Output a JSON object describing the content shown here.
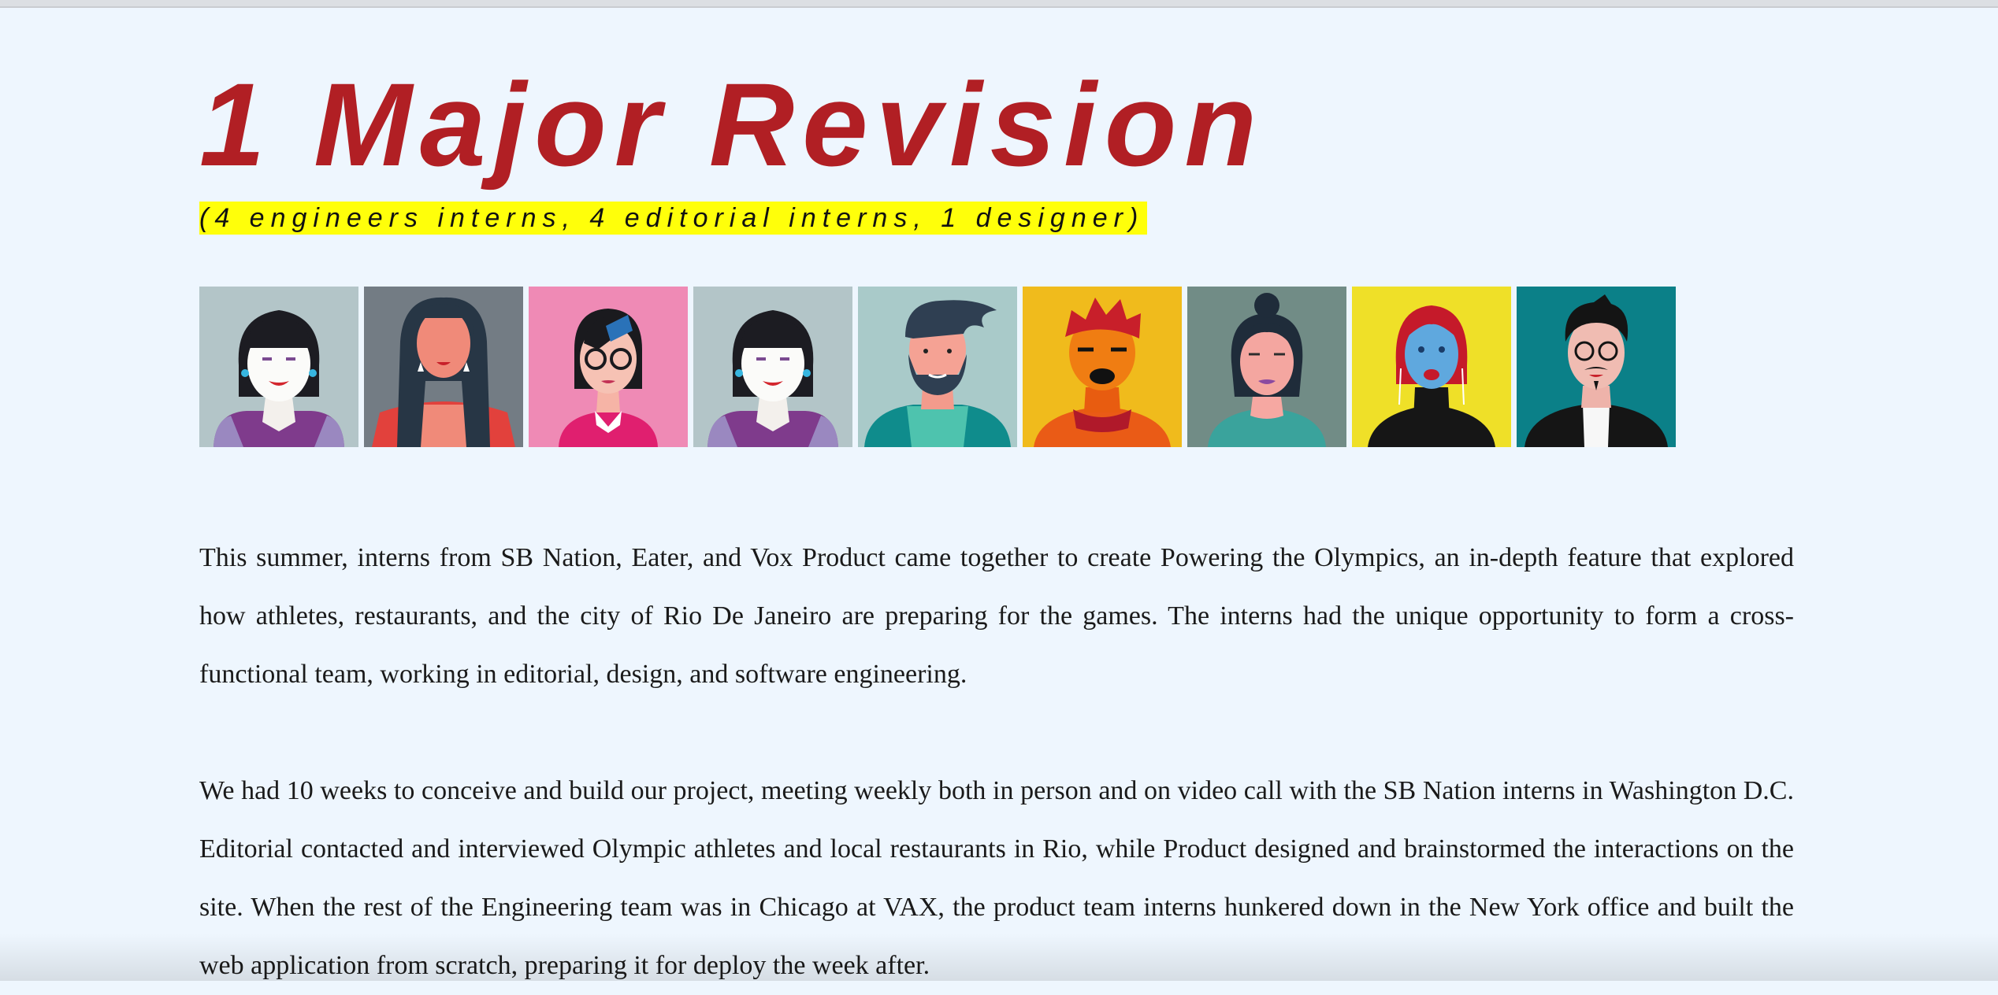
{
  "article": {
    "title": "1 Major Revision",
    "subtitle": "(4 engineers interns, 4 editorial interns, 1 designer)",
    "paragraphs": [
      "This summer, interns from SB Nation, Eater, and Vox Product came together to create Powering the Olympics, an in-depth feature that explored how athletes, restaurants, and the city of Rio De Janeiro are preparing for the games. The interns had the unique opportunity to form a cross-functional team, working in editorial, design, and software engineering.",
      "We had 10 weeks to conceive and build our project, meeting weekly both in person and on video call with the SB Nation interns in Washington D.C. Editorial contacted and interviewed Olympic athletes and local restaurants in Rio, while Product designed and brainstormed the interactions on the site. When the rest of the Engineering team was in Chicago at VAX, the product team interns hunkered down in the New York office and built the web application from scratch, preparing it for deploy the week after."
    ]
  },
  "colors": {
    "title": "#b11f24",
    "highlight": "#ffff0a",
    "background": "#eef6fe"
  },
  "avatars": [
    {
      "icon": "woman-black-bob-avatar-icon",
      "bg": "#b3c5c8"
    },
    {
      "icon": "woman-long-hair-avatar-icon",
      "bg": "#737c84"
    },
    {
      "icon": "woman-glasses-pink-avatar-icon",
      "bg": "#ef8ab5"
    },
    {
      "icon": "woman-black-bob-avatar-icon",
      "bg": "#b3c5c8"
    },
    {
      "icon": "man-beard-avatar-icon",
      "bg": "#a9cac9"
    },
    {
      "icon": "man-orange-avatar-icon",
      "bg": "#f0bb1c"
    },
    {
      "icon": "woman-bun-avatar-icon",
      "bg": "#718c86"
    },
    {
      "icon": "woman-blue-face-avatar-icon",
      "bg": "#efe028"
    },
    {
      "icon": "man-glasses-mustache-avatar-icon",
      "bg": "#0b8088"
    }
  ]
}
